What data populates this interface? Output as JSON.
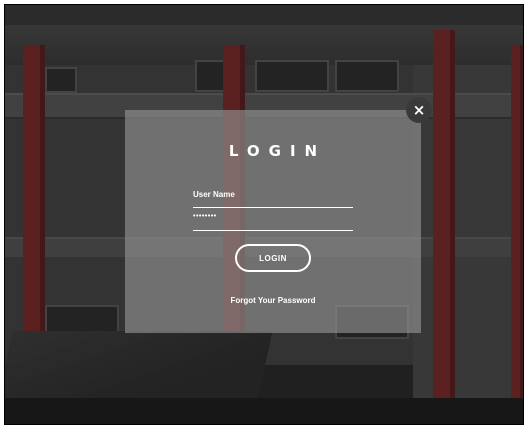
{
  "dialog": {
    "title": "LOGIN",
    "username": {
      "value": "User Name"
    },
    "password": {
      "value": "••••••••"
    },
    "login_button": "LOGIN",
    "forgot_link": "Forgot Your Password",
    "close_symbol": "×"
  },
  "icons": {
    "close": "close-icon"
  },
  "colors": {
    "overlay": "#969696",
    "text": "#ffffff",
    "column_accent": "#7a2b2b",
    "close_bg": "#3a3a3a"
  }
}
